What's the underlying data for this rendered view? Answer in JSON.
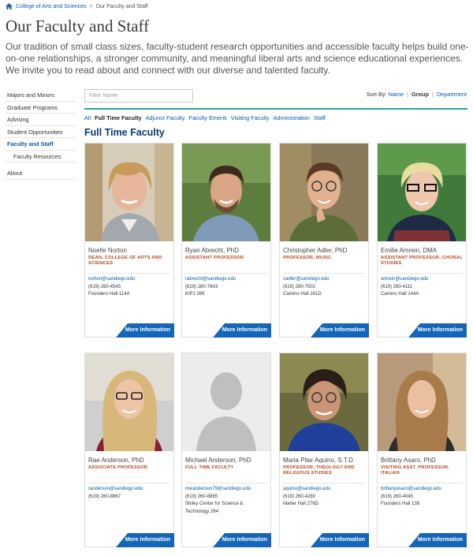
{
  "breadcrumb": {
    "home_icon": "house-icon",
    "items": [
      "College of Arts and Sciences",
      "Our Faculty and Staff"
    ],
    "separator": ">"
  },
  "page": {
    "title": "Our Faculty and Staff",
    "intro": "Our tradition of small class sizes, faculty-student research opportunities and accessible faculty helps build one-on-one relationships, a stronger community, and meaningful liberal arts and science educational experiences. We invite you to read about and connect with our diverse and talented faculty."
  },
  "sidebar": {
    "items": [
      {
        "label": "Majors and Minors"
      },
      {
        "label": "Graduate Programs"
      },
      {
        "label": "Advising"
      },
      {
        "label": "Student Opportunities"
      },
      {
        "label": "Faculty and Staff"
      },
      {
        "label": "Faculty Resources"
      },
      {
        "label": "About"
      }
    ]
  },
  "filter": {
    "placeholder": "Filter Name",
    "value": ""
  },
  "sort": {
    "label": "Sort By:",
    "options": [
      "Name",
      "Group",
      "Department"
    ],
    "selected": "Group",
    "separator": "|"
  },
  "tabs": [
    {
      "label": "All"
    },
    {
      "label": "Full Time Faculty"
    },
    {
      "label": "Adjunct Faculty"
    },
    {
      "label": "Faculty Emeriti"
    },
    {
      "label": "Visiting Faculty"
    },
    {
      "label": "Administration"
    },
    {
      "label": "Staff"
    }
  ],
  "section": {
    "title": "Full Time Faculty"
  },
  "colors": {
    "accent_rule": "#2aa6a8",
    "link": "#0a5aa6",
    "title_orange": "#b5461b",
    "button_blue": "#1565b9",
    "heading_navy": "#0b3a6e"
  },
  "cards": [
    {
      "name": "Noelle Norton",
      "title": "DEAN, COLLEGE OF ARTS AND SCIENCES",
      "email": "norton@sandiego.edu",
      "phone": "(619) 260-4545",
      "office": "Founders Hall 114A",
      "button": "More Information"
    },
    {
      "name": "Ryan Abrecht, PhD",
      "title": "ASSISTANT PROFESSOR",
      "email": "rabrecht@sandiego.edu",
      "phone": "(619) 260-7843",
      "office": "KIPJ 289",
      "button": "More Information"
    },
    {
      "name": "Christopher Adler, PhD",
      "title": "PROFESSOR, MUSIC",
      "email": "cadler@sandiego.edu",
      "phone": "(619) 260-7502",
      "office": "Camino Hall 161D",
      "button": "More Information"
    },
    {
      "name": "Emilie Amrein, DMA",
      "title": "ASSISTANT PROFESSOR, CHORAL STUDIES",
      "email": "amrein@sandiego.edu",
      "phone": "(619) 260-4111",
      "office": "Camino Hall 144A",
      "button": "More Information"
    },
    {
      "name": "Rae Anderson, PhD",
      "title": "ASSOCIATE PROFESSOR",
      "email": "randerson@sandiego.edu",
      "phone": "(619) 260-8867",
      "office": "",
      "button": "More Information"
    },
    {
      "name": "Michael Anderson, PhD",
      "title": "FULL TIME FACULTY",
      "email": "mwanderson79@sandiego.edu",
      "phone": "(619) 260-8865",
      "office": "Shiley Center for Science & Technology 284",
      "button": "More Information"
    },
    {
      "name": "Maria Pilar Aquino, S.T.D.",
      "title": "PROFESSOR, THEOLOGY AND RELIGIOUS STUDIES",
      "email": "aquino@sandiego.edu",
      "phone": "(619) 260-4280",
      "office": "Maher Hall 276D",
      "button": "More Information"
    },
    {
      "name": "Brittany Asaro, PhD",
      "title": "VISITING ASST. PROFESSOR, ITALIAN",
      "email": "brittanyasaro@sandiego.edu",
      "phone": "(619) 260-4045",
      "office": "Founders Hall 138",
      "button": "More Information"
    }
  ]
}
